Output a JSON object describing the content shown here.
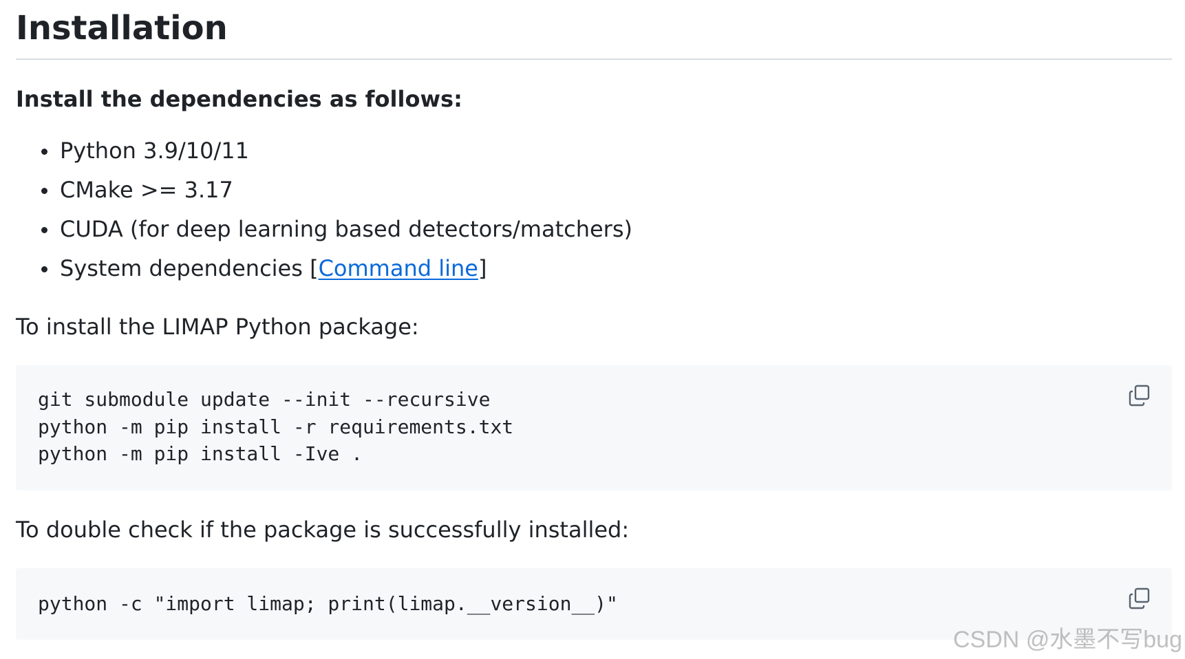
{
  "heading": "Installation",
  "subheading": "Install the dependencies as follows:",
  "dependencies": [
    {
      "text": "Python 3.9/10/11"
    },
    {
      "text": "CMake >= 3.17"
    },
    {
      "text": "CUDA (for deep learning based detectors/matchers)"
    },
    {
      "text_before": "System dependencies [",
      "link": "Command line",
      "text_after": "]"
    }
  ],
  "install_intro": "To install the LIMAP Python package:",
  "install_code": "git submodule update --init --recursive\npython -m pip install -r requirements.txt\npython -m pip install -Ive .",
  "check_intro": "To double check if the package is successfully installed:",
  "check_code": "python -c \"import limap; print(limap.__version__)\"",
  "copy_icon": "copy-icon",
  "link_color": "#0969da",
  "code_bg": "#f6f8fa",
  "watermark": "CSDN @水墨不写bug"
}
